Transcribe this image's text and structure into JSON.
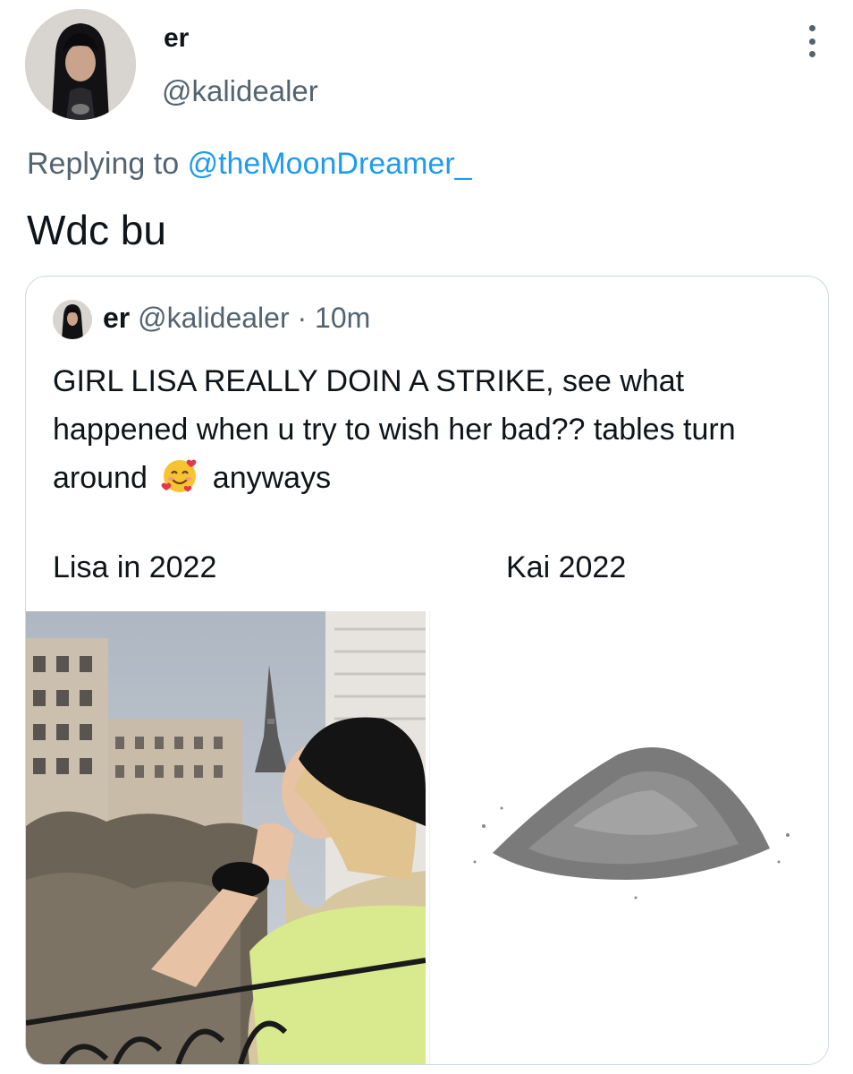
{
  "tweet": {
    "display_name": "er",
    "handle": "@kalidealer",
    "reply_prefix": "Replying to",
    "reply_to": "@theMoonDreamer_",
    "text": "Wdc bu",
    "menu_icon": "more-vertical-icon"
  },
  "quote": {
    "display_name": "er",
    "handle": "@kalidealer",
    "separator": "·",
    "time": "10m",
    "text_part1": "GIRL LISA REALLY DOIN A STRIKE, see what happened when u try to wish her bad?? tables turn around",
    "emoji": "smiling-face-with-hearts-emoji",
    "text_part2": "anyways",
    "image_caption_left": "Lisa in 2022",
    "image_caption_right": "Kai 2022"
  },
  "colors": {
    "text": "#0f1419",
    "secondary": "#536471",
    "link": "#1d9bf0",
    "border": "#cfd9de"
  }
}
